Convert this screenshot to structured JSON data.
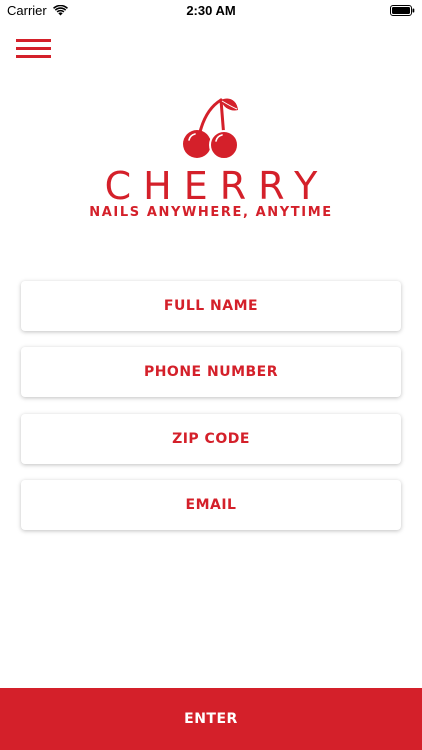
{
  "status_bar": {
    "carrier": "Carrier",
    "time": "2:30 AM",
    "icons": [
      "wifi-icon",
      "battery-icon"
    ]
  },
  "menu": {
    "icon": "hamburger-menu-icon"
  },
  "brand": {
    "icon": "cherry-icon",
    "name": "CHERRY",
    "tagline": "NAILS ANYWHERE, ANYTIME"
  },
  "form": {
    "full_name": {
      "placeholder": "FULL NAME",
      "value": ""
    },
    "phone_number": {
      "placeholder": "PHONE NUMBER",
      "value": ""
    },
    "zip_code": {
      "placeholder": "ZIP CODE",
      "value": ""
    },
    "email": {
      "placeholder": "EMAIL",
      "value": ""
    }
  },
  "enter_button": {
    "label": "ENTER"
  },
  "colors": {
    "accent": "#d4202a",
    "background": "#ffffff",
    "button_text": "#ffffff"
  }
}
